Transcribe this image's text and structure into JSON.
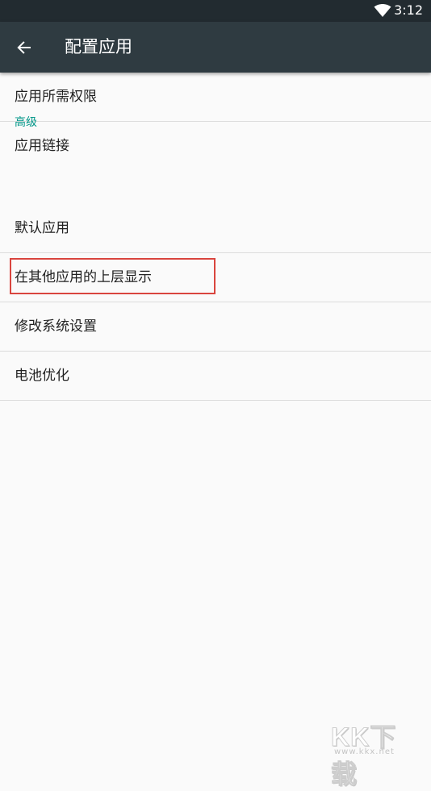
{
  "status_bar": {
    "time": "3:12",
    "wifi_icon": "wifi-icon"
  },
  "app_bar": {
    "back_icon": "arrow-back-icon",
    "title": "配置应用"
  },
  "list": {
    "items": [
      {
        "label": "应用所需权限"
      },
      {
        "label": "应用链接"
      }
    ],
    "section_header": "高级",
    "advanced_items": [
      {
        "label": "默认应用"
      },
      {
        "label": "在其他应用的上层显示"
      },
      {
        "label": "修改系统设置"
      },
      {
        "label": "电池优化"
      }
    ]
  },
  "watermark": {
    "logo_text": "KK下载",
    "url": "www.kkx.net"
  },
  "colors": {
    "status_bar_bg": "#222b30",
    "app_bar_bg": "#2f3b41",
    "section_accent": "#009688",
    "highlight_border": "#d9453e",
    "page_bg": "#fafafa"
  }
}
